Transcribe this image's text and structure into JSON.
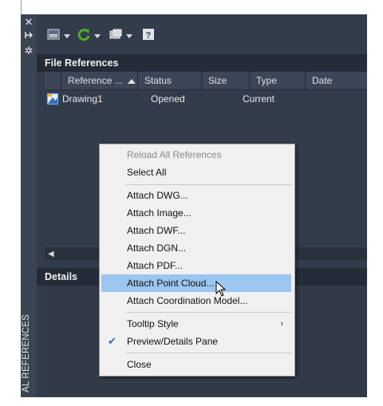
{
  "palette": {
    "vertical_title": "AL REFERENCES",
    "icons": [
      "close-icon",
      "auto-hide-icon",
      "properties-icon"
    ]
  },
  "toolbar": {
    "attach_icon": "attach-dwg-icon",
    "refresh_icon": "refresh-icon",
    "change_path_icon": "change-path-icon",
    "help_icon": "help-icon"
  },
  "file_references": {
    "header": "File References",
    "columns": [
      "Reference ...",
      "Status",
      "Size",
      "Type",
      "Date"
    ],
    "rows": [
      {
        "name": "Drawing1",
        "status": "Opened",
        "size": "",
        "type": "Current",
        "date": ""
      }
    ]
  },
  "details": {
    "header": "Details"
  },
  "context_menu": {
    "items": [
      {
        "label": "Reload All References",
        "disabled": true
      },
      {
        "label": "Select All"
      },
      {
        "label": "Attach DWG..."
      },
      {
        "label": "Attach Image..."
      },
      {
        "label": "Attach DWF..."
      },
      {
        "label": "Attach DGN..."
      },
      {
        "label": "Attach PDF..."
      },
      {
        "label": "Attach Point Cloud...",
        "highlighted": true
      },
      {
        "label": "Attach Coordination Model..."
      },
      {
        "label": "Tooltip Style",
        "submenu": true
      },
      {
        "label": "Preview/Details Pane",
        "checked": true
      },
      {
        "label": "Close"
      }
    ]
  },
  "colors": {
    "panel_bg": "#333c4a",
    "header_bg": "#252c38",
    "menu_highlight": "#9ac6ef"
  }
}
